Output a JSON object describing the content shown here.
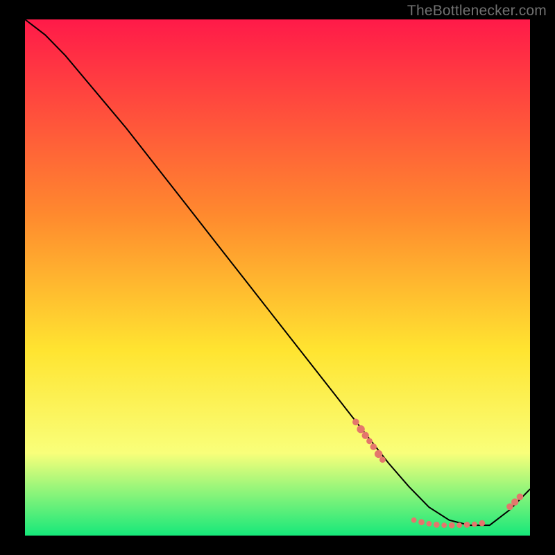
{
  "watermark": "TheBottlenecker.com",
  "colors": {
    "gradient_top": "#ff1a49",
    "gradient_mid1": "#ff8a2e",
    "gradient_mid2": "#ffe430",
    "gradient_mid3": "#f9ff7a",
    "gradient_bottom": "#16e87a",
    "line": "#000000",
    "dot": "#e4766c",
    "frame": "#000000"
  },
  "chart_data": {
    "type": "line",
    "title": "",
    "xlabel": "",
    "ylabel": "",
    "xlim": [
      0,
      100
    ],
    "ylim": [
      0,
      100
    ],
    "series": [
      {
        "name": "bottleneck-curve",
        "x": [
          0,
          4,
          8,
          14,
          20,
          26,
          32,
          38,
          44,
          50,
          56,
          62,
          68,
          72,
          76,
          80,
          84,
          88,
          92,
          96,
          100
        ],
        "y": [
          100,
          97,
          93,
          86,
          79,
          71.5,
          64,
          56.5,
          49,
          41.5,
          34,
          26.5,
          19,
          14,
          9.5,
          5.5,
          3,
          2,
          2,
          5,
          9
        ]
      }
    ],
    "dot_clusters": [
      {
        "name": "cluster-left-slope",
        "points": [
          {
            "x": 65.5,
            "y": 22.0,
            "r": 1.1
          },
          {
            "x": 66.5,
            "y": 20.6,
            "r": 1.3
          },
          {
            "x": 67.4,
            "y": 19.4,
            "r": 1.2
          },
          {
            "x": 68.2,
            "y": 18.3,
            "r": 1.0
          },
          {
            "x": 69.0,
            "y": 17.2,
            "r": 1.1
          },
          {
            "x": 70.0,
            "y": 15.8,
            "r": 1.3
          },
          {
            "x": 70.8,
            "y": 14.7,
            "r": 1.0
          }
        ]
      },
      {
        "name": "cluster-valley",
        "points": [
          {
            "x": 77.0,
            "y": 3.0,
            "r": 0.9
          },
          {
            "x": 78.5,
            "y": 2.6,
            "r": 1.0
          },
          {
            "x": 80.0,
            "y": 2.3,
            "r": 0.9
          },
          {
            "x": 81.5,
            "y": 2.1,
            "r": 1.0
          },
          {
            "x": 83.0,
            "y": 2.0,
            "r": 0.9
          },
          {
            "x": 84.5,
            "y": 2.0,
            "r": 1.0
          },
          {
            "x": 86.0,
            "y": 2.0,
            "r": 0.9
          },
          {
            "x": 87.5,
            "y": 2.1,
            "r": 1.0
          },
          {
            "x": 89.0,
            "y": 2.2,
            "r": 0.9
          },
          {
            "x": 90.5,
            "y": 2.4,
            "r": 1.0
          }
        ]
      },
      {
        "name": "cluster-right-slope",
        "points": [
          {
            "x": 96.0,
            "y": 5.6,
            "r": 1.1
          },
          {
            "x": 97.0,
            "y": 6.5,
            "r": 1.2
          },
          {
            "x": 98.0,
            "y": 7.5,
            "r": 1.1
          }
        ]
      }
    ]
  }
}
